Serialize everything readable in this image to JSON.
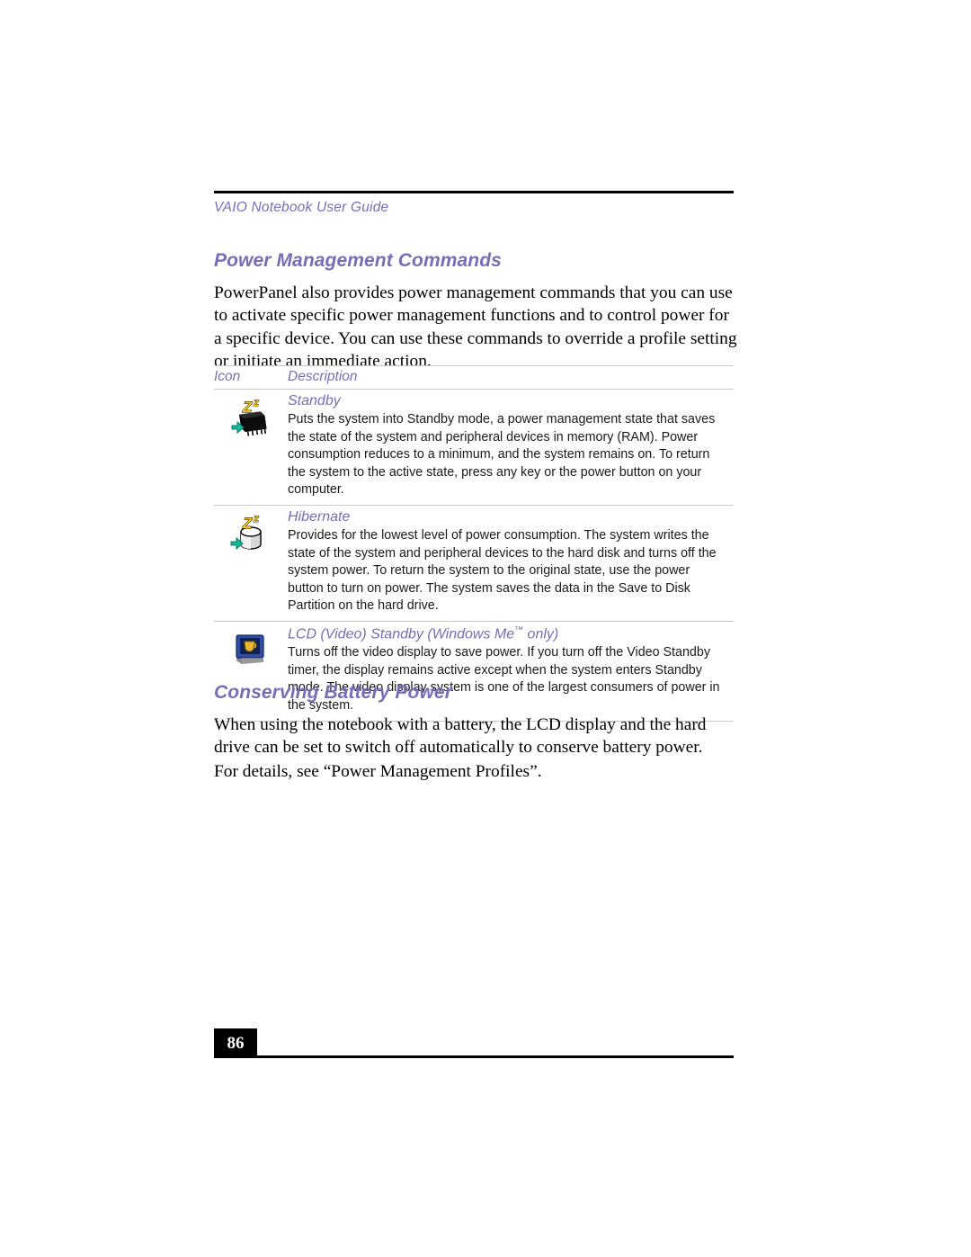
{
  "document": {
    "running_header": "VAIO Notebook User Guide",
    "page_number": "86",
    "heading_color": "#7a6cb8",
    "rule_color": "#000000",
    "table_rule_color": "#c9c9c9"
  },
  "sections": {
    "power_management": {
      "heading": "Power Management Commands",
      "intro": "PowerPanel also provides power management commands that you can use to activate specific power management functions and to control power for a specific device. You can use these commands to override a profile setting or initiate an immediate action."
    },
    "conserving_battery": {
      "heading": "Conserving Battery Power",
      "paragraph_1": "When using the notebook with a battery, the LCD display and the hard drive can be set to switch off automatically to conserve battery power.",
      "paragraph_2": "For details, see “Power Management Profiles”."
    }
  },
  "commands_table": {
    "columns": {
      "icon": "Icon",
      "description": "Description"
    },
    "rows": [
      {
        "icon_name": "standby-chip-icon",
        "title": "Standby",
        "title_suffix": "",
        "text": "Puts the system into Standby mode, a power management state that saves the state of the system and peripheral devices in memory (RAM). Power consumption reduces to a minimum, and the system remains on. To return the system to the active state, press any key or the power button on your computer."
      },
      {
        "icon_name": "hibernate-disk-icon",
        "title": "Hibernate",
        "title_suffix": "",
        "text": "Provides for the lowest level of power consumption. The system writes the state of the system and peripheral devices to the hard disk and turns off the system power. To return the system to the original state, use the power button to turn on power. The system saves the data in the Save to Disk Partition on the hard drive."
      },
      {
        "icon_name": "lcd-video-standby-icon",
        "title": "LCD (Video) Standby (Windows Me",
        "title_suffix": " only)",
        "text": "Turns off the video display to save power. If you turn off the Video Standby timer, the display remains active except when the system enters Standby mode. The video display system is one of the largest consumers of power in the system."
      }
    ]
  }
}
